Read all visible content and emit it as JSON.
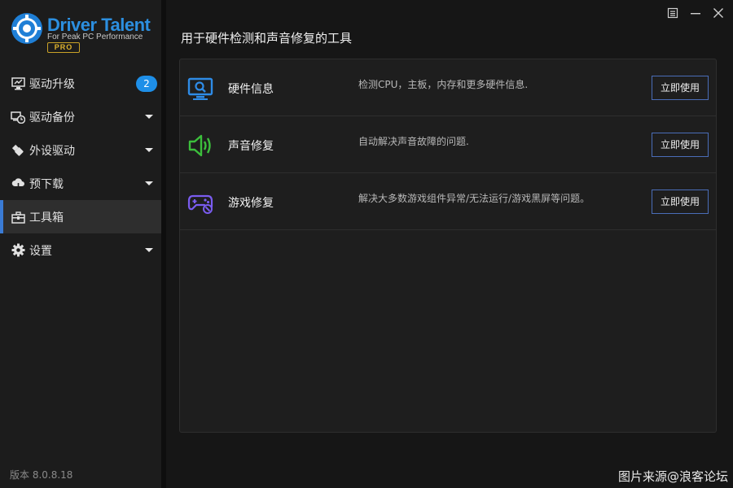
{
  "logo": {
    "title": "Driver Talent",
    "subtitle": "For Peak PC Performance",
    "edition": "PRO"
  },
  "sidebar": {
    "items": [
      {
        "label": "驱动升级",
        "icon": "monitor-upgrade-icon",
        "badge": "2",
        "caret": false,
        "active": false
      },
      {
        "label": "驱动备份",
        "icon": "backup-clock-icon",
        "badge": "",
        "caret": true,
        "active": false
      },
      {
        "label": "外设驱动",
        "icon": "usb-plug-icon",
        "badge": "",
        "caret": true,
        "active": false
      },
      {
        "label": "预下载",
        "icon": "cloud-download-icon",
        "badge": "",
        "caret": true,
        "active": false
      },
      {
        "label": "工具箱",
        "icon": "toolbox-icon",
        "badge": "",
        "caret": false,
        "active": true
      },
      {
        "label": "设置",
        "icon": "gear-icon",
        "badge": "",
        "caret": true,
        "active": false
      }
    ],
    "version": "版本 8.0.8.18"
  },
  "window_controls": [
    "menu-icon",
    "minimize-icon",
    "close-icon"
  ],
  "main": {
    "title": "用于硬件检测和声音修复的工具",
    "tools": [
      {
        "name": "硬件信息",
        "icon": "hardware-monitor-icon",
        "description": "检测CPU，主板，内存和更多硬件信息.",
        "button": "立即使用",
        "icon_color": "#2e8be6"
      },
      {
        "name": "声音修复",
        "icon": "speaker-icon",
        "description": "自动解决声音故障的问题.",
        "button": "立即使用",
        "icon_color": "#3cbf3c"
      },
      {
        "name": "游戏修复",
        "icon": "gamepad-icon",
        "description": "解决大多数游戏组件异常/无法运行/游戏黑屏等问题。",
        "button": "立即使用",
        "icon_color": "#7a5cf0"
      }
    ]
  },
  "watermark": "图片来源@浪客论坛",
  "colors": {
    "accent": "#3a7bd5",
    "badge": "#1e8fe8",
    "brand": "#2c8fe0",
    "pro": "#e0b42e"
  }
}
